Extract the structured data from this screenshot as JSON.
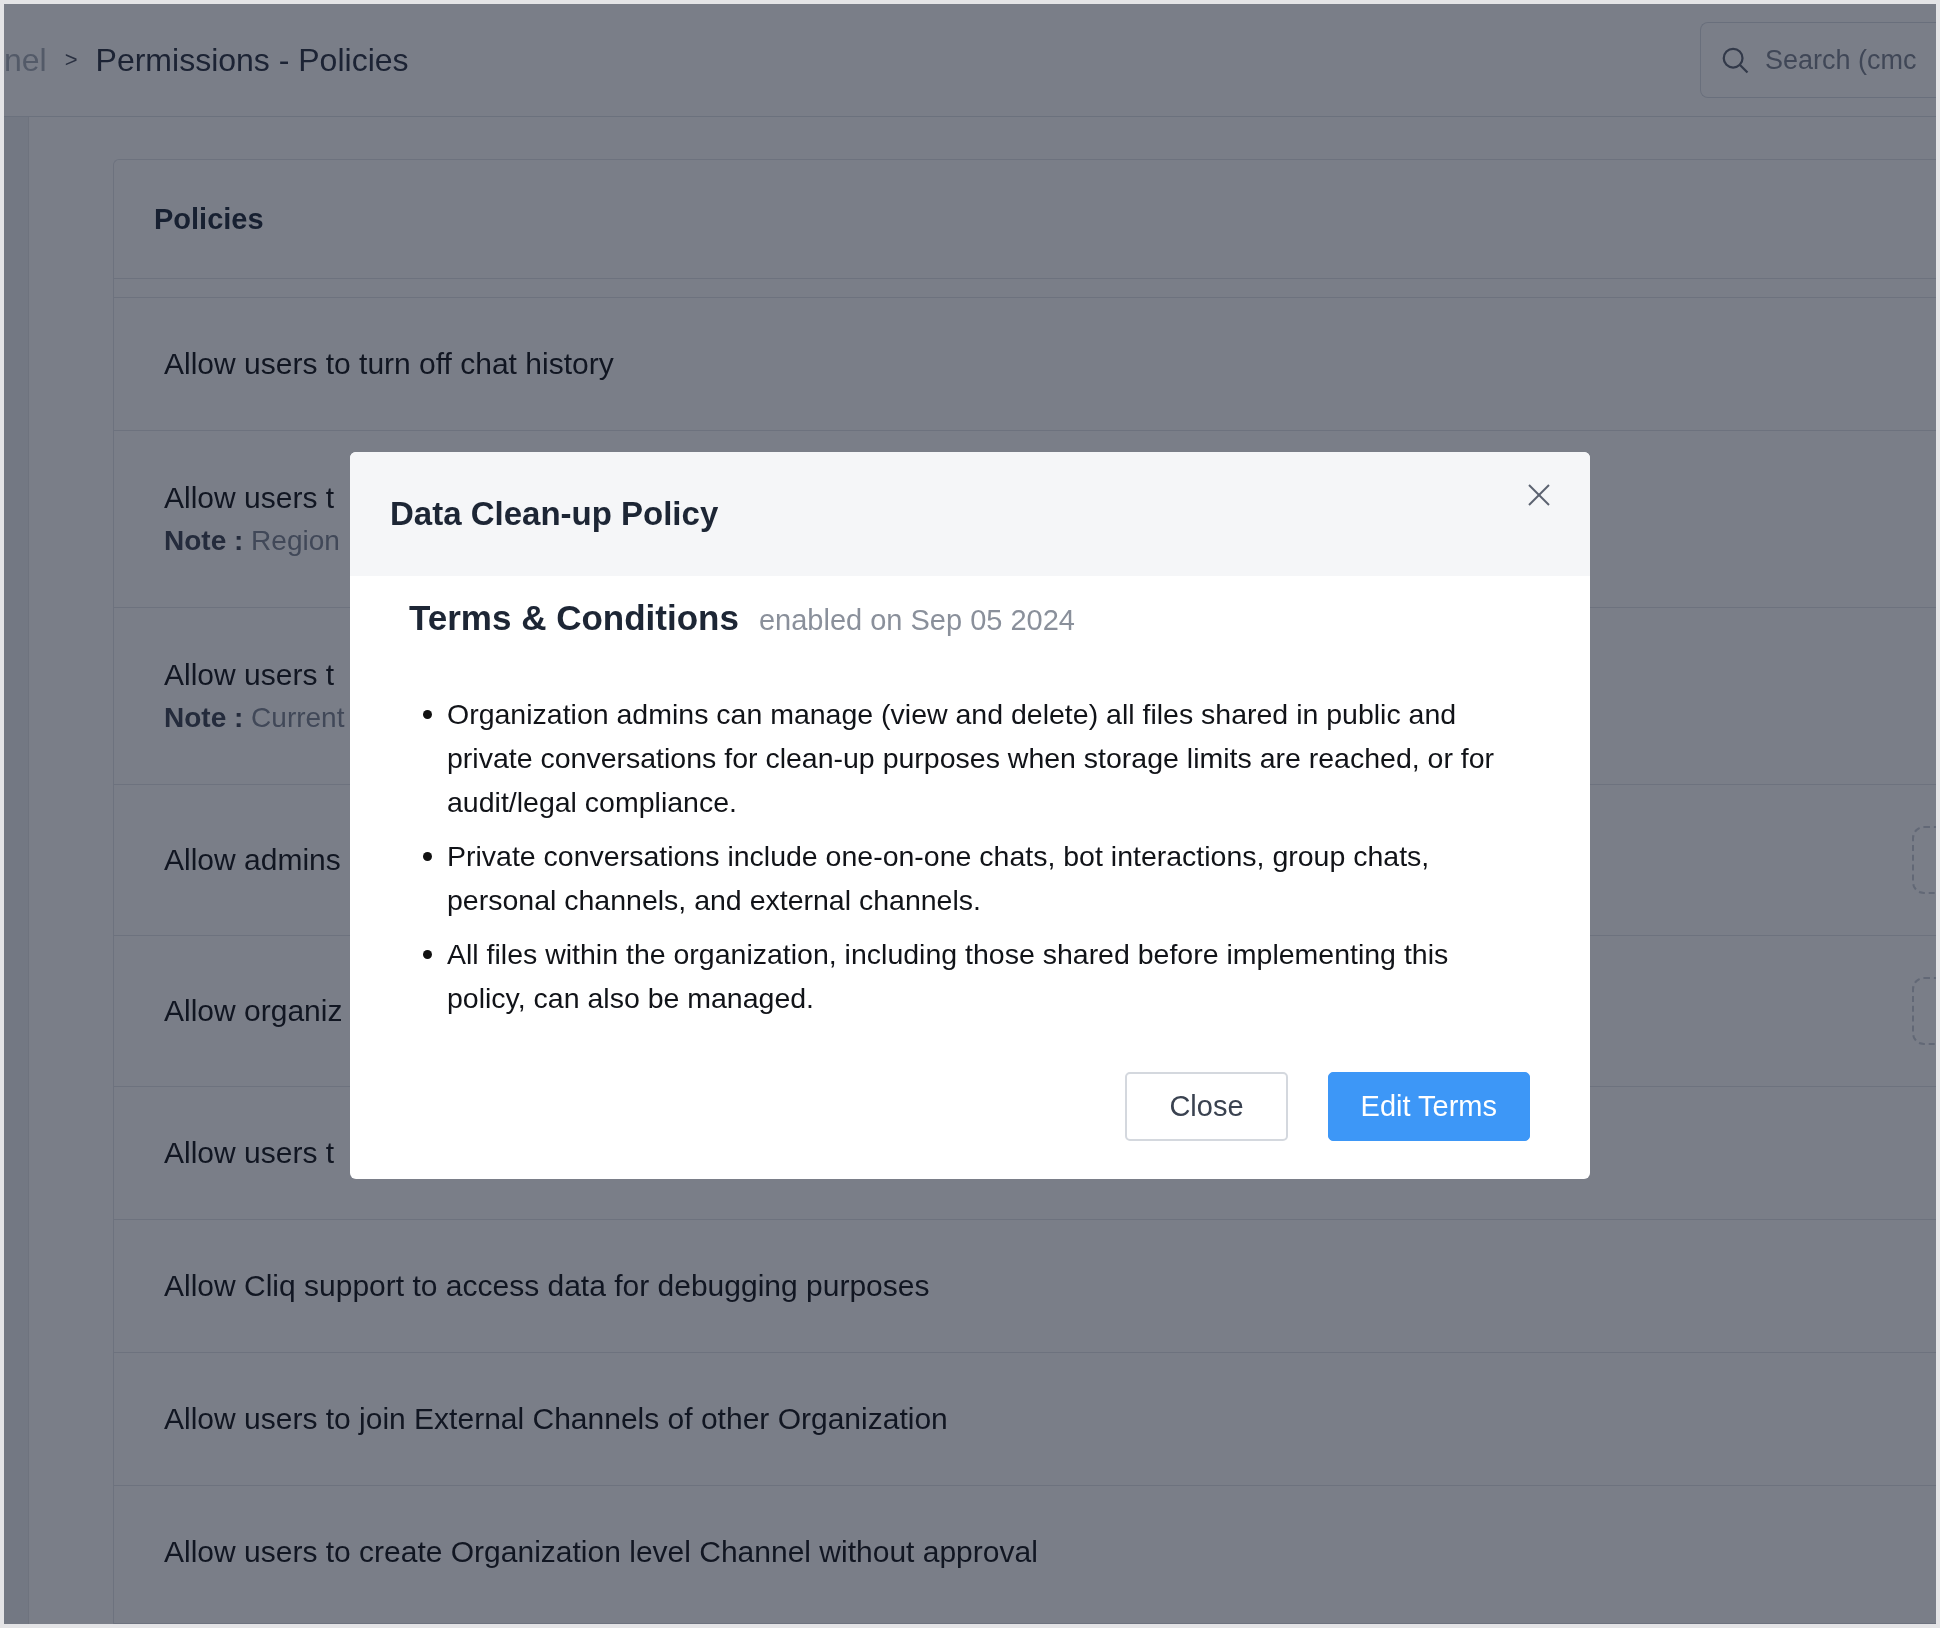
{
  "breadcrumb": {
    "items": [
      {
        "label": "nel"
      },
      {
        "label": "Permissions - Policies"
      }
    ],
    "separator": ">"
  },
  "search": {
    "placeholder": "Search (cmc"
  },
  "card": {
    "title": "Policies",
    "rows": [
      {
        "label": "Allow users to turn off chat history",
        "control": false
      },
      {
        "label": "Allow users t",
        "note_label": "Note :",
        "note": "Region",
        "control": false
      },
      {
        "label": "Allow users t",
        "note_label": "Note :",
        "note": "Current",
        "control": false
      },
      {
        "label": "Allow admins",
        "control": true
      },
      {
        "label": "Allow organiz",
        "control": true
      },
      {
        "label": "Allow users t",
        "control": false
      },
      {
        "label": "Allow Cliq support to access data for debugging purposes",
        "control": false
      },
      {
        "label": "Allow users to join External Channels of other Organization",
        "control": false
      },
      {
        "label": "Allow users to create Organization level Channel without approval",
        "control": false
      }
    ]
  },
  "modal": {
    "title": "Data Clean-up Policy",
    "heading": "Terms & Conditions",
    "status": "enabled on Sep 05 2024",
    "items": [
      "Organization admins can manage (view and delete) all files shared in public and private conversations for clean-up purposes when storage limits are reached, or for audit/legal compliance.",
      "Private conversations include one-on-one chats, bot interactions, group chats, personal channels, and external channels.",
      "All files within the organization, including those shared before implementing this policy, can also be managed."
    ],
    "buttons": [
      {
        "label": "Close",
        "kind": "secondary"
      },
      {
        "label": "Edit Terms",
        "kind": "primary"
      }
    ]
  }
}
